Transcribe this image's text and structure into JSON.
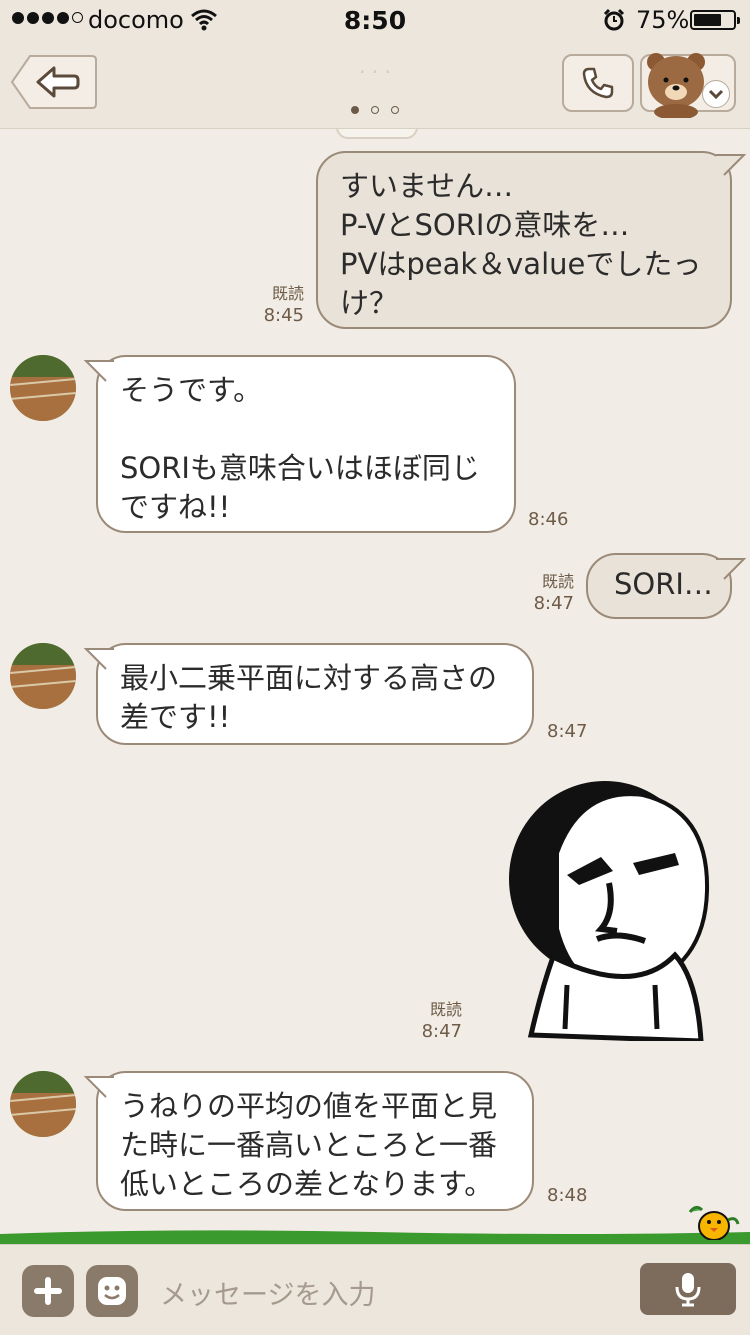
{
  "status_bar": {
    "carrier": "docomo",
    "time": "8:50",
    "battery_percent": "75%",
    "battery_level": 0.75
  },
  "header": {
    "title": "· ·  ·",
    "page_count": 3,
    "active_page": 1
  },
  "messages": [
    {
      "direction": "out",
      "text": "すいません…\nP-VとSORIの意味を…\nPVはpeak＆valueでしたっけ？",
      "read": "既読",
      "time": "8:45"
    },
    {
      "direction": "in",
      "text": "そうです。\n\nSORIも意味合いはほぼ同じですね!!",
      "time": "8:46"
    },
    {
      "direction": "out",
      "text": "SORI…",
      "read": "既読",
      "time": "8:47"
    },
    {
      "direction": "in",
      "text": "最小二乗平面に対する高さの差です!!",
      "time": "8:47"
    },
    {
      "direction": "out",
      "type": "sticker",
      "read": "既読",
      "time": "8:47"
    },
    {
      "direction": "in",
      "text": "うねりの平均の値を平面と見た時に一番高いところと一番低いところの差となります。",
      "time": "8:48"
    }
  ],
  "input_bar": {
    "placeholder": "メッセージを入力"
  },
  "colors": {
    "background": "#f1ece5",
    "bubble_out": "#e9e2d8",
    "bubble_in": "#ffffff",
    "bubble_border": "#9b8a78",
    "meta_text": "#6e5c48",
    "input_button": "#8a7a6a"
  }
}
